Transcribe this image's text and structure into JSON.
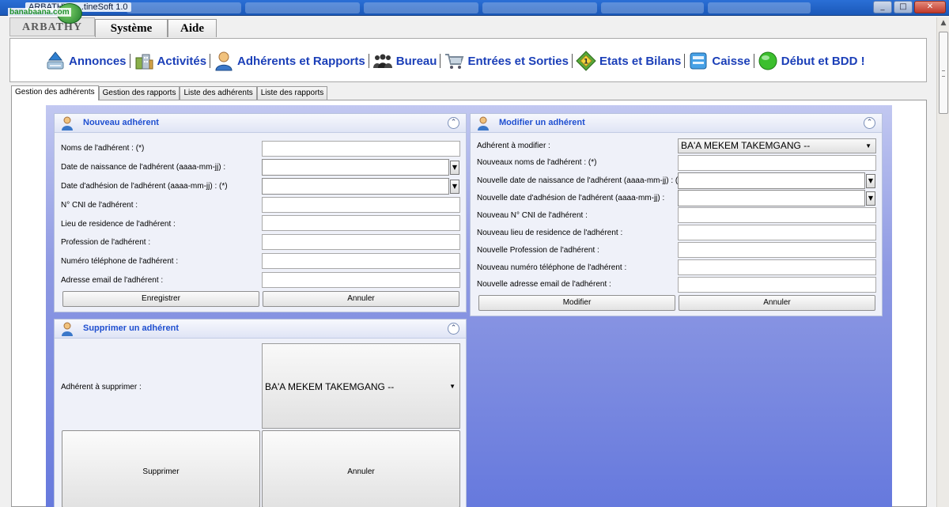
{
  "window": {
    "title": "ARBATHY - ...tineSoft 1.0",
    "controls": [
      "_",
      "□",
      "✕"
    ]
  },
  "watermark": {
    "text": "banabaana.com"
  },
  "menu": {
    "app_name": "ARBATHY",
    "items": [
      "Système",
      "Aide"
    ]
  },
  "toolbar": {
    "items": [
      {
        "label": "Annonces",
        "icon": "announcements-icon"
      },
      {
        "label": "Activités",
        "icon": "activities-icon"
      },
      {
        "label": "Adhérents et Rapports",
        "icon": "members-icon"
      },
      {
        "label": "Bureau",
        "icon": "office-icon"
      },
      {
        "label": "Entrées et Sorties",
        "icon": "cart-icon"
      },
      {
        "label": "Etats et Bilans",
        "icon": "reports-icon"
      },
      {
        "label": "Caisse",
        "icon": "cash-register-icon"
      },
      {
        "label": "Début et BDD !",
        "icon": "database-icon"
      }
    ],
    "separator": "|"
  },
  "tabs": [
    {
      "label": "Gestion des adhérents",
      "active": true
    },
    {
      "label": "Gestion des rapports",
      "active": false
    },
    {
      "label": "Liste des adhérents",
      "active": false
    },
    {
      "label": "Liste des rapports",
      "active": false
    }
  ],
  "new_member": {
    "title": "Nouveau adhérent",
    "collapse": "⌃",
    "fields": [
      "Noms de l'adhérent : (*)",
      "Date de naissance de l'adhérent (aaaa-mm-jj) :",
      "Date d'adhésion de l'adhérent (aaaa-mm-jj) : (*)",
      "N° CNI de l'adhérent :",
      "Lieu de residence de l'adhérent :",
      "Profession de l'adhérent :",
      "Numéro téléphone de l'adhérent :",
      "Adresse email de l'adhérent :"
    ],
    "save": "Enregistrer",
    "cancel": "Annuler"
  },
  "modify_member": {
    "title": "Modifier un adhérent",
    "collapse": "⌃",
    "select_label": "Adhérent à modifier :",
    "select_value": "BA'A MEKEM TAKEMGANG --",
    "fields": [
      "Nouveaux noms de l'adhérent : (*)",
      "Nouvelle date de naissance de l'adhérent (aaaa-mm-jj) : (*)",
      "Nouvelle date d'adhésion de l'adhérent  (aaaa-mm-jj) :",
      "Nouveau N° CNI de l'adhérent :",
      "Nouveau lieu de residence de l'adhérent :",
      "Nouvelle Profession de l'adhérent :",
      "Nouveau numéro téléphone de l'adhérent :",
      "Nouvelle adresse email de l'adhérent :"
    ],
    "modify": "Modifier",
    "cancel": "Annuler"
  },
  "delete_member": {
    "title": "Supprimer un adhérent",
    "collapse": "⌃",
    "select_label": "Adhérent à supprimer :",
    "select_value": "BA'A MEKEM TAKEMGANG --",
    "delete": "Supprimer",
    "cancel": "Annuler"
  },
  "colors": {
    "accent": "#1b3fb8",
    "panel_title": "#1f4fd0",
    "content_bg": "#6679dd"
  }
}
